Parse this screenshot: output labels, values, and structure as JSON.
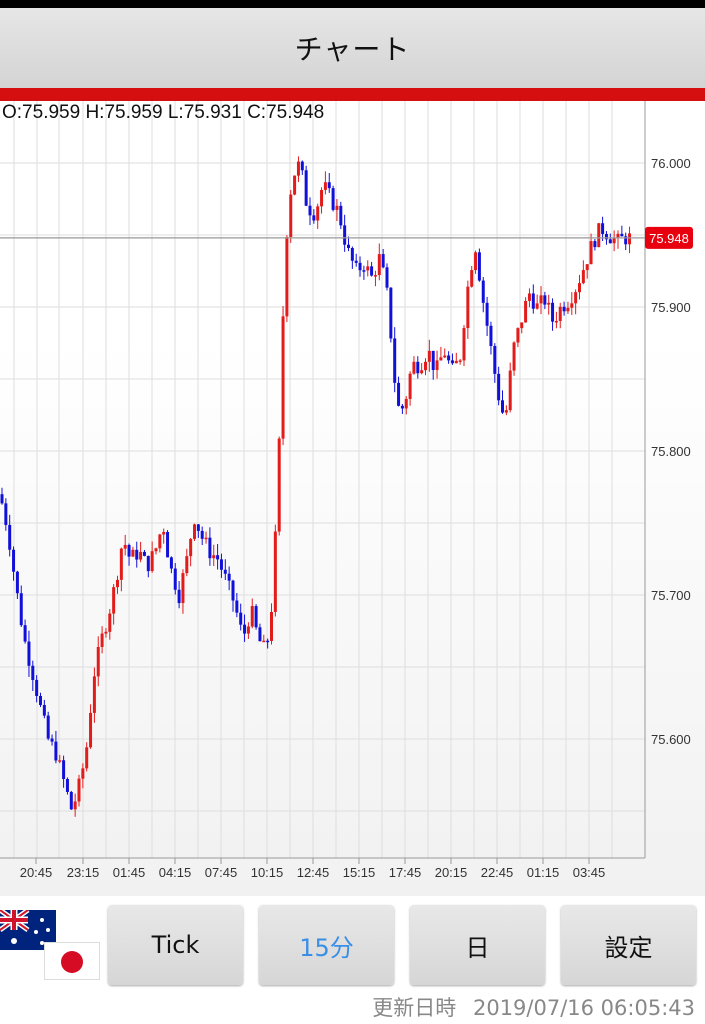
{
  "status_bar": {},
  "header": {
    "title": "チャート"
  },
  "ohlc_readout": "O:75.959 H:75.959 L:75.931 C:75.948",
  "colors": {
    "up": "#e21b1b",
    "down": "#1010d8",
    "accent": "#d50f0f",
    "current_price_badge": "#e8000e"
  },
  "chart_data": {
    "type": "candlestick",
    "title": "",
    "xlabel": "",
    "ylabel": "",
    "x_tick_labels": [
      "20:45",
      "23:15",
      "01:45",
      "04:15",
      "07:45",
      "10:15",
      "12:45",
      "15:15",
      "17:45",
      "20:15",
      "22:45",
      "01:15",
      "03:45"
    ],
    "y_tick_labels": [
      "76.000",
      "75.900",
      "75.800",
      "75.700",
      "75.600"
    ],
    "ylim": [
      75.535,
      76.035
    ],
    "grid": true,
    "current_price": 75.948,
    "current_price_label": "75.948",
    "close_path": [
      [
        0,
        75.77
      ],
      [
        8,
        75.745
      ],
      [
        15,
        75.71
      ],
      [
        24,
        75.67
      ],
      [
        33,
        75.645
      ],
      [
        41,
        75.62
      ],
      [
        48,
        75.6
      ],
      [
        56,
        75.59
      ],
      [
        64,
        75.57
      ],
      [
        72,
        75.55
      ],
      [
        79,
        75.567
      ],
      [
        86,
        75.59
      ],
      [
        94,
        75.645
      ],
      [
        102,
        75.67
      ],
      [
        109,
        75.688
      ],
      [
        116,
        75.71
      ],
      [
        123,
        75.74
      ],
      [
        130,
        75.725
      ],
      [
        139,
        75.73
      ],
      [
        147,
        75.72
      ],
      [
        155,
        75.73
      ],
      [
        163,
        75.75
      ],
      [
        170,
        75.72
      ],
      [
        179,
        75.7
      ],
      [
        187,
        75.725
      ],
      [
        194,
        75.755
      ],
      [
        202,
        75.74
      ],
      [
        210,
        75.73
      ],
      [
        218,
        75.725
      ],
      [
        226,
        75.71
      ],
      [
        234,
        75.695
      ],
      [
        243,
        75.67
      ],
      [
        251,
        75.69
      ],
      [
        258,
        75.67
      ],
      [
        266,
        75.66
      ],
      [
        273,
        75.7
      ],
      [
        279,
        75.8
      ],
      [
        285,
        75.94
      ],
      [
        292,
        75.99
      ],
      [
        300,
        76.0
      ],
      [
        307,
        75.97
      ],
      [
        315,
        75.965
      ],
      [
        323,
        75.985
      ],
      [
        331,
        75.975
      ],
      [
        339,
        75.965
      ],
      [
        347,
        75.94
      ],
      [
        356,
        75.925
      ],
      [
        364,
        75.93
      ],
      [
        372,
        75.92
      ],
      [
        380,
        75.935
      ],
      [
        388,
        75.905
      ],
      [
        397,
        75.83
      ],
      [
        404,
        75.83
      ],
      [
        412,
        75.86
      ],
      [
        420,
        75.86
      ],
      [
        428,
        75.87
      ],
      [
        436,
        75.855
      ],
      [
        444,
        75.87
      ],
      [
        452,
        75.855
      ],
      [
        460,
        75.865
      ],
      [
        467,
        75.91
      ],
      [
        475,
        75.945
      ],
      [
        483,
        75.905
      ],
      [
        490,
        75.875
      ],
      [
        498,
        75.84
      ],
      [
        505,
        75.82
      ],
      [
        513,
        75.87
      ],
      [
        521,
        75.89
      ],
      [
        529,
        75.91
      ],
      [
        537,
        75.9
      ],
      [
        545,
        75.905
      ],
      [
        553,
        75.89
      ],
      [
        561,
        75.9
      ],
      [
        569,
        75.905
      ],
      [
        577,
        75.915
      ],
      [
        585,
        75.93
      ],
      [
        593,
        75.945
      ],
      [
        601,
        75.955
      ],
      [
        609,
        75.95
      ],
      [
        617,
        75.945
      ],
      [
        624,
        75.948
      ]
    ]
  },
  "toolbar": {
    "tick_label": "Tick",
    "interval_label": "15分",
    "day_label": "日",
    "settings_label": "設定"
  },
  "currency_pair": {
    "base_flag": "australia-flag-icon",
    "quote_flag": "japan-flag-icon"
  },
  "updated": {
    "label": "更新日時",
    "timestamp": "2019/07/16 06:05:43"
  }
}
